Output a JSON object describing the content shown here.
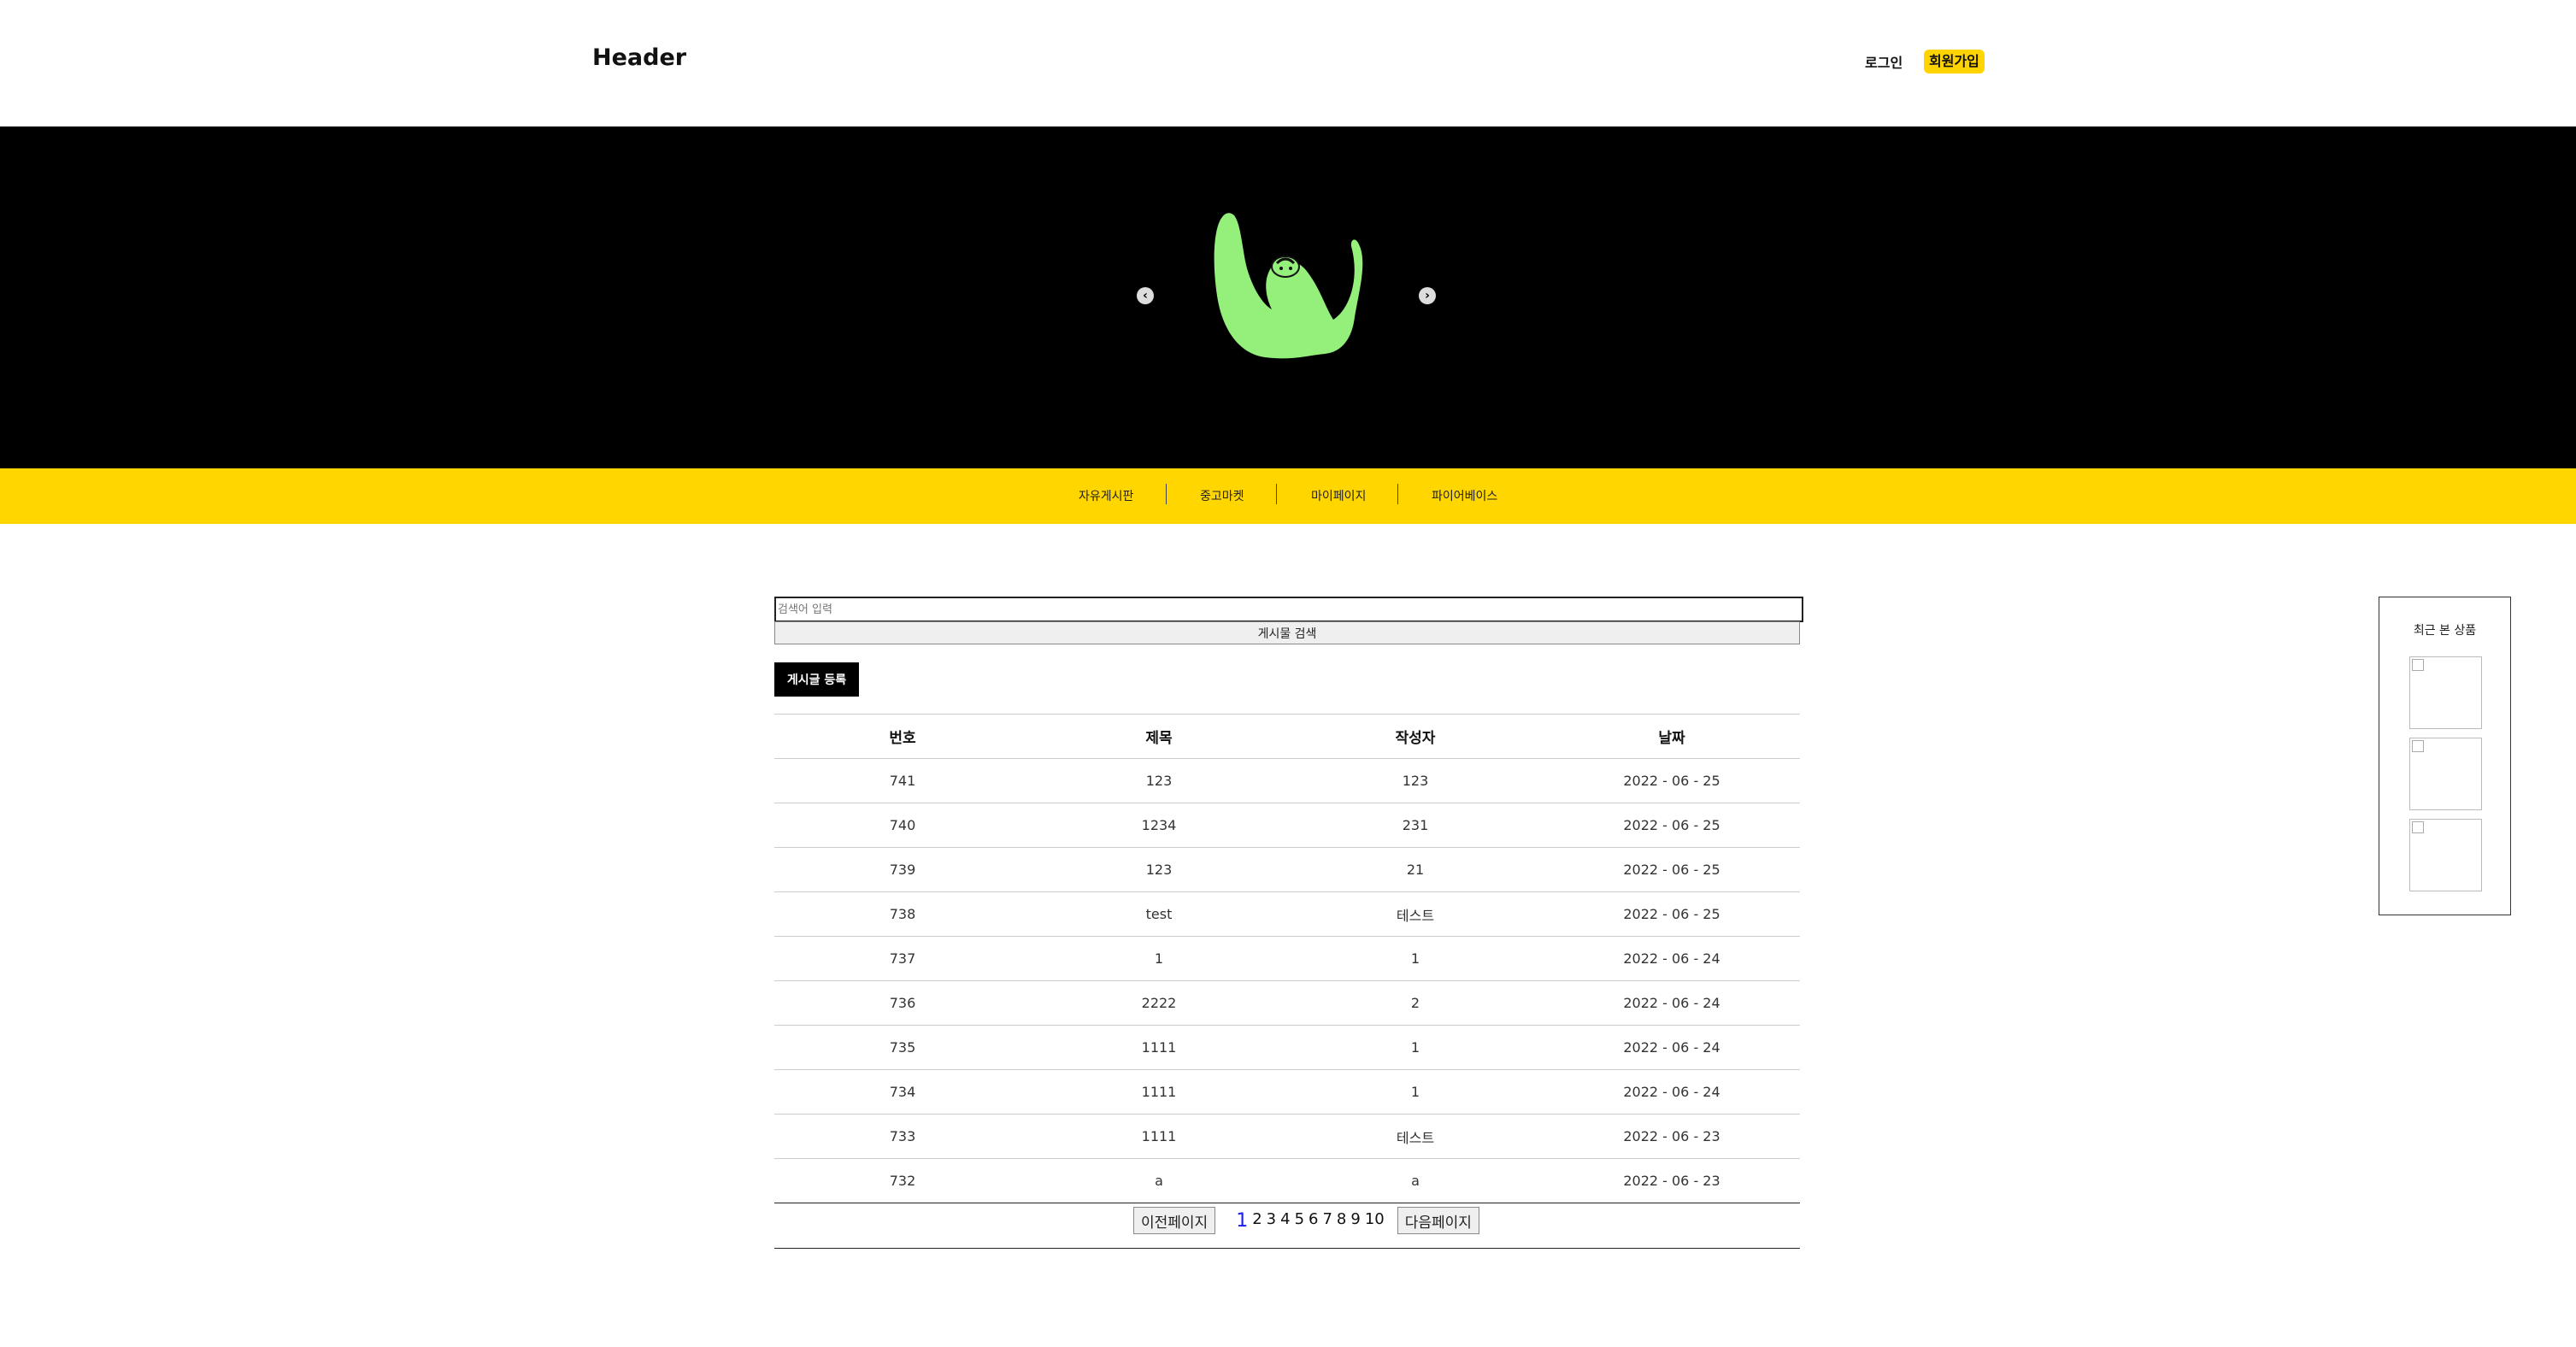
{
  "header": {
    "logo": "Header",
    "login": "로그인",
    "signup": "회원가입"
  },
  "banner": {
    "prev_icon": "chevron-left-icon",
    "next_icon": "chevron-right-icon",
    "mascot_color": "#94f07a"
  },
  "nav": {
    "items": [
      "자유게시판",
      "중고마켓",
      "마이페이지",
      "파이어베이스"
    ]
  },
  "search": {
    "placeholder": "검색어 입력",
    "button_label": "게시물 검색"
  },
  "write_button": "게시글 등록",
  "board": {
    "columns": [
      "번호",
      "제목",
      "작성자",
      "날짜"
    ],
    "rows": [
      [
        "741",
        "123",
        "123",
        "2022 - 06 - 25"
      ],
      [
        "740",
        "1234",
        "231",
        "2022 - 06 - 25"
      ],
      [
        "739",
        "123",
        "21",
        "2022 - 06 - 25"
      ],
      [
        "738",
        "test",
        "테스트",
        "2022 - 06 - 25"
      ],
      [
        "737",
        "1",
        "1",
        "2022 - 06 - 24"
      ],
      [
        "736",
        "2222",
        "2",
        "2022 - 06 - 24"
      ],
      [
        "735",
        "1111",
        "1",
        "2022 - 06 - 24"
      ],
      [
        "734",
        "1111",
        "1",
        "2022 - 06 - 24"
      ],
      [
        "733",
        "1111",
        "테스트",
        "2022 - 06 - 23"
      ],
      [
        "732",
        "a",
        "a",
        "2022 - 06 - 23"
      ]
    ]
  },
  "pager": {
    "prev": "이전페이지",
    "next": "다음페이지",
    "pages": [
      "1",
      "2",
      "3",
      "4",
      "5",
      "6",
      "7",
      "8",
      "9",
      "10"
    ],
    "current": "1"
  },
  "recent": {
    "title": "최근 본 상품"
  },
  "colors": {
    "accent": "#ffd600",
    "banner_bg": "#000000",
    "active_page": "#1a1aff"
  }
}
